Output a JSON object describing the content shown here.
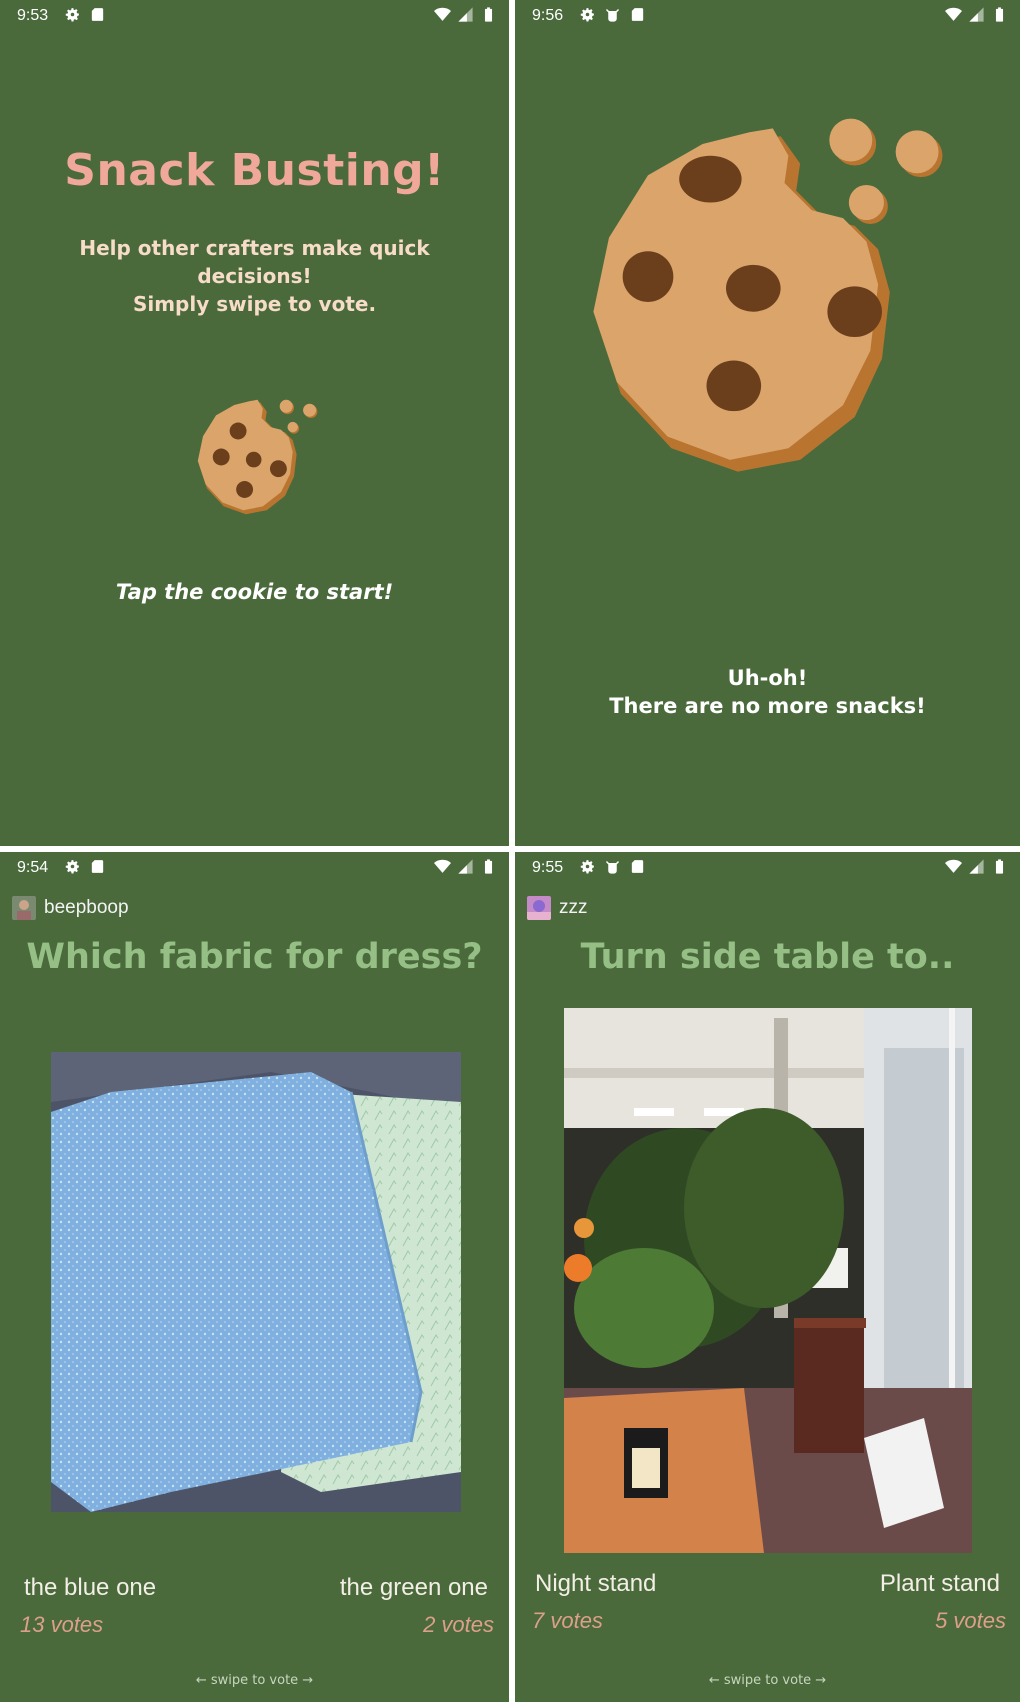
{
  "screens": {
    "intro": {
      "time": "9:53",
      "title": "Snack Busting!",
      "subtitle": "Help other crafters make quick decisions!\nSimply swipe to vote.",
      "tap_hint": "Tap the cookie to start!"
    },
    "empty": {
      "time": "9:56",
      "message": "Uh-oh!\nThere are no more snacks!"
    },
    "poll_fabric": {
      "time": "9:54",
      "username": "beepboop",
      "question": "Which fabric for dress?",
      "option_left": "the blue one",
      "option_right": "the green one",
      "votes_left": "13 votes",
      "votes_right": "2 votes",
      "swipe_hint": "← swipe to vote →"
    },
    "poll_table": {
      "time": "9:55",
      "username": "zzz",
      "question": "Turn side table to..",
      "option_left": "Night stand",
      "option_right": "Plant stand",
      "votes_left": "7 votes",
      "votes_right": "5 votes",
      "swipe_hint": "← swipe to vote →"
    }
  },
  "colors": {
    "background": "#4a6a3c",
    "title_pink": "#f0a89a",
    "question_green": "#95bf85",
    "cookie": "#dba46b",
    "cookie_edge": "#b97530",
    "chip": "#6b3f1c"
  },
  "icons": [
    "settings-icon",
    "sd-card-icon",
    "android-debug-icon",
    "wifi-icon",
    "signal-icon",
    "battery-icon"
  ]
}
